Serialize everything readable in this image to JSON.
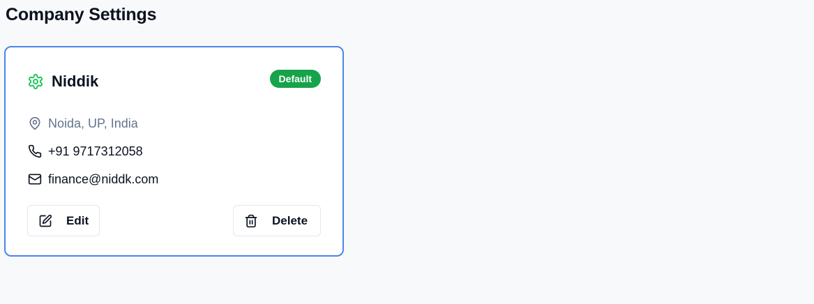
{
  "page": {
    "title": "Company Settings"
  },
  "company": {
    "name": "Niddik",
    "badge": "Default",
    "location": "Noida, UP, India",
    "phone": "+91 9717312058",
    "email": "finance@niddk.com"
  },
  "actions": {
    "edit_label": "Edit",
    "delete_label": "Delete"
  },
  "icons": {
    "company": "gear-icon",
    "location": "map-pin-icon",
    "phone": "phone-icon",
    "email": "mail-icon",
    "edit": "edit-icon",
    "delete": "trash-icon"
  },
  "colors": {
    "accent_border": "#4a86e8",
    "badge_bg": "#16a34a",
    "gear_icon": "#22c55e",
    "muted_text": "#64748b"
  }
}
